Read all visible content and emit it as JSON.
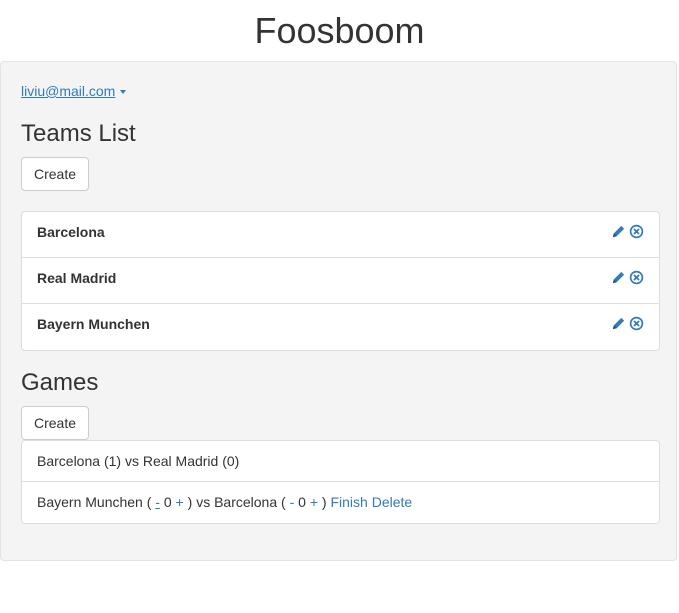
{
  "app": {
    "title": "Foosboom"
  },
  "user": {
    "email": "liviu@mail.com"
  },
  "teams": {
    "heading": "Teams List",
    "create_label": "Create",
    "items": [
      {
        "name": "Barcelona"
      },
      {
        "name": "Real Madrid"
      },
      {
        "name": "Bayern Munchen"
      }
    ]
  },
  "games": {
    "heading": "Games",
    "create_label": "Create",
    "finished": {
      "home": "Barcelona",
      "home_score": "(1)",
      "vs": "vs",
      "away": "Real Madrid",
      "away_score": "(0)"
    },
    "active": {
      "home": "Bayern Munchen",
      "open_paren": "(",
      "home_minus": "-",
      "home_score": "0",
      "home_plus": "+",
      "close_paren": ")",
      "vs": "vs",
      "away": "Barcelona",
      "away_minus": "-",
      "away_score": "0",
      "away_plus": "+",
      "finish_label": "Finish",
      "delete_label": "Delete"
    }
  },
  "colors": {
    "link": "#337ab7",
    "panel_bg": "#f4f4f4"
  },
  "icons": {
    "edit": "pencil-icon",
    "remove": "remove-circle-icon"
  }
}
